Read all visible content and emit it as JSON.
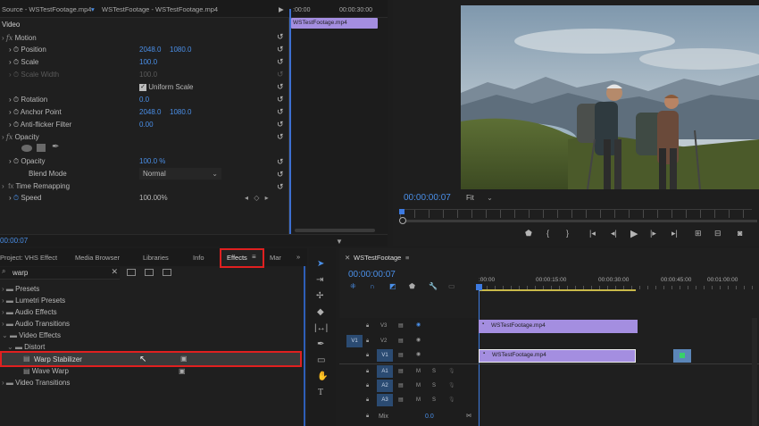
{
  "ec": {
    "source_tab": "Source - WSTestFootage.mp4",
    "clip_tab": "WSTestFootage - WSTestFootage.mp4",
    "tc_start": ":00:00",
    "tc_end": "00:00:30:00",
    "mini_clip": "WSTestFootage.mp4",
    "video_label": "Video",
    "motion": "Motion",
    "position": "Position",
    "position_x": "2048.0",
    "position_y": "1080.0",
    "scale": "Scale",
    "scale_val": "100.0",
    "scale_width": "Scale Width",
    "scale_width_val": "100.0",
    "uniform_scale": "Uniform Scale",
    "rotation": "Rotation",
    "rotation_val": "0.0",
    "anchor_point": "Anchor Point",
    "anchor_x": "2048.0",
    "anchor_y": "1080.0",
    "antiflicker": "Anti-flicker Filter",
    "antiflicker_val": "0.00",
    "opacity_section": "Opacity",
    "opacity": "Opacity",
    "opacity_val": "100.0 %",
    "blend_mode": "Blend Mode",
    "blend_val": "Normal",
    "time_remap": "Time Remapping",
    "speed": "Speed",
    "speed_val": "100.00%",
    "timecode": "00:00:07"
  },
  "program": {
    "timecode": "00:00:00:07",
    "fit": "Fit"
  },
  "project": {
    "tabs": [
      "Project: VHS Effect",
      "Media Browser",
      "Libraries",
      "Info",
      "Effects",
      "Mar"
    ],
    "search": "warp",
    "tree": [
      {
        "label": "Presets"
      },
      {
        "label": "Lumetri Presets"
      },
      {
        "label": "Audio Effects"
      },
      {
        "label": "Audio Transitions"
      },
      {
        "label": "Video Effects"
      },
      {
        "label": "Distort"
      },
      {
        "label": "Warp Stabilizer"
      },
      {
        "label": "Wave Warp"
      },
      {
        "label": "Video Transitions"
      }
    ]
  },
  "timeline": {
    "sequence": "WSTestFootage",
    "timecode": "00:00:00:07",
    "ruler": [
      ":00:00",
      "00:00:15:00",
      "00:00:30:00",
      "00:00:45:00",
      "00:01:00:00"
    ],
    "tracks": {
      "v3": "V3",
      "v2": "V2",
      "v1": "V1",
      "v1src": "V1",
      "a1": "A1",
      "a2": "A2",
      "a3": "A3",
      "m": "M",
      "s": "S",
      "mix": "Mix",
      "mix_val": "0.0"
    },
    "clip_v3": "WSTestFootage.mp4",
    "clip_v1": "WSTestFootage.mp4"
  },
  "colors": {
    "accent_blue": "#4a8fe8",
    "clip_purple": "#a48ee0",
    "highlight_red": "#e02020"
  }
}
